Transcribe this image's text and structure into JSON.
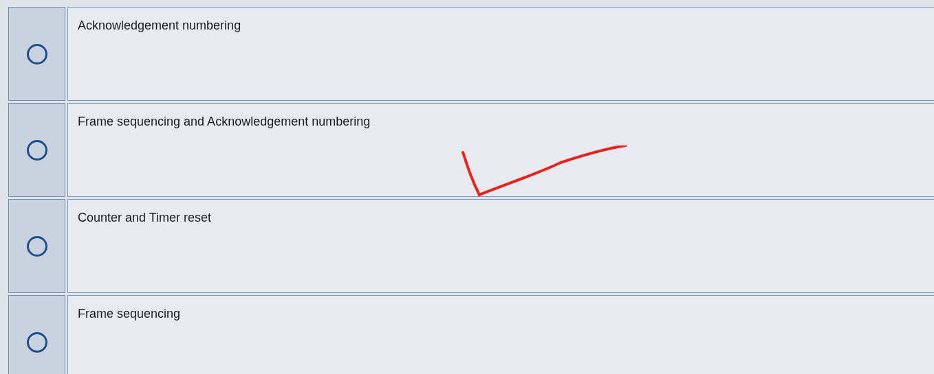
{
  "options": [
    {
      "label": "Acknowledgement numbering",
      "selected": false,
      "marked": false
    },
    {
      "label": "Frame sequencing and Acknowledgement numbering",
      "selected": false,
      "marked": true
    },
    {
      "label": "Counter and Timer reset",
      "selected": false,
      "marked": false
    },
    {
      "label": "Frame sequencing",
      "selected": false,
      "marked": false
    }
  ]
}
